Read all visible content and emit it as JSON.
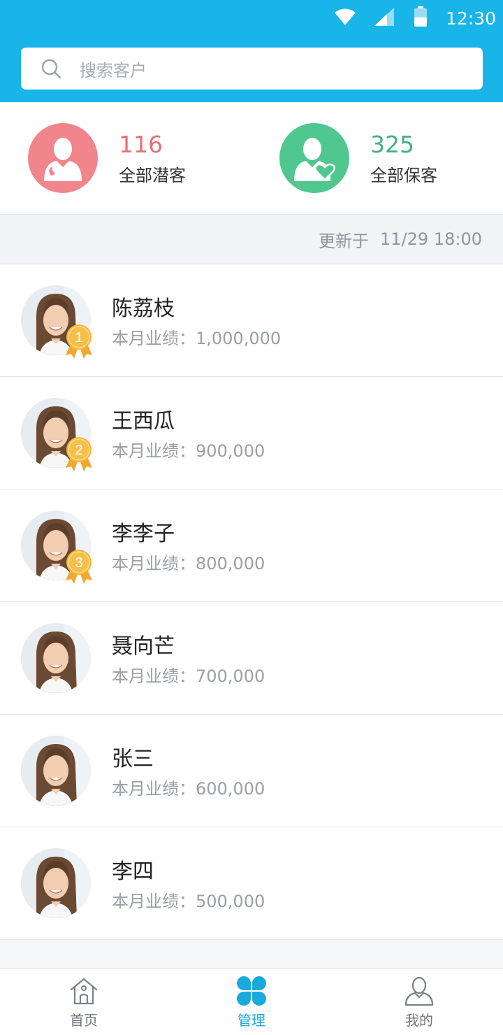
{
  "status_bar": {
    "time": "12:30",
    "icons": [
      "wifi-icon",
      "signal-icon",
      "battery-icon"
    ]
  },
  "search": {
    "placeholder": "搜索客户",
    "icon": "search-icon"
  },
  "summary": {
    "potential": {
      "count": "116",
      "label": "全部潜客",
      "color": "#f0868b",
      "icon": "user-phone-icon"
    },
    "retained": {
      "count": "325",
      "label": "全部保客",
      "color": "#4fc78f",
      "icon": "user-heart-icon"
    }
  },
  "updated": {
    "prefix": "更新于",
    "time": "11/29 18:00"
  },
  "ranking": [
    {
      "name": "陈荔枝",
      "performance": "本月业绩：1,000,000",
      "rank_badge": "1"
    },
    {
      "name": "王西瓜",
      "performance": "本月业绩：900,000",
      "rank_badge": "2"
    },
    {
      "name": "李李子",
      "performance": "本月业绩：800,000",
      "rank_badge": "3"
    },
    {
      "name": "聂向芒",
      "performance": "本月业绩：700,000",
      "rank_badge": null
    },
    {
      "name": "张三",
      "performance": "本月业绩：600,000",
      "rank_badge": null
    },
    {
      "name": "李四",
      "performance": "本月业绩：500,000",
      "rank_badge": null
    }
  ],
  "nav": {
    "items": [
      {
        "label": "首页",
        "icon": "home-icon",
        "active": false
      },
      {
        "label": "管理",
        "icon": "clover-grid-icon",
        "active": true
      },
      {
        "label": "我的",
        "icon": "person-icon",
        "active": false
      }
    ]
  },
  "colors": {
    "header": "#19b4e8",
    "accent": "#19a9dc",
    "medal": "#f5b53a"
  }
}
